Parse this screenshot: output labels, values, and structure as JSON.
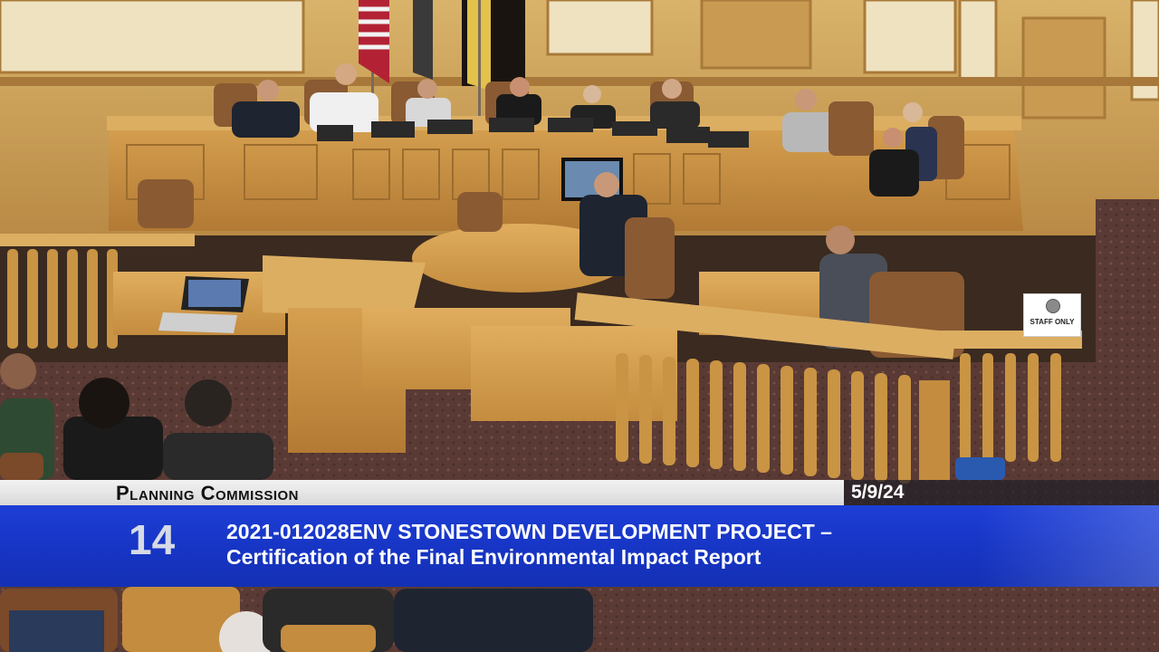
{
  "broadcast": {
    "commission": "Planning Commission",
    "date": "5/9/24",
    "item_number": "14",
    "item_title_line1": "2021-012028ENV STONESTOWN DEVELOPMENT PROJECT –",
    "item_title_line2": "Certification of the Final Environmental Impact Report"
  },
  "sign": {
    "text": "STAFF ONLY"
  },
  "colors": {
    "overlay_blue": "#1a38cc",
    "strip_gray": "#e6e6e6",
    "wood": "#c8913f",
    "carpet": "#5a3a34"
  }
}
